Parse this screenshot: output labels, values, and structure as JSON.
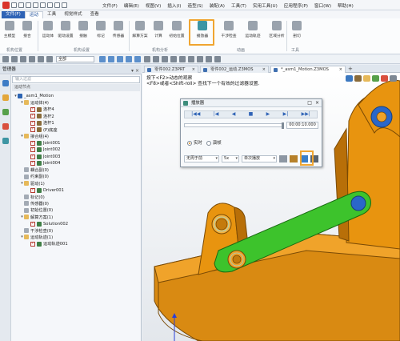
{
  "menu": {
    "file": "文件(F)",
    "items": [
      "文件(F)",
      "编辑(E)",
      "视图(V)",
      "插入(I)",
      "造型(S)",
      "装配(A)",
      "工具(T)",
      "实用工具(U)",
      "应用程序(P)",
      "窗口(W)",
      "帮助(H)"
    ]
  },
  "ribbon_tabs": {
    "file": "文件(F)",
    "items": [
      "运动",
      "工具",
      "视觉样式",
      "查看"
    ]
  },
  "ribbon": {
    "buttons": [
      "主模型",
      "接合",
      "运动体",
      "驱动设置",
      "接触",
      "标记",
      "传感器",
      "解算方案",
      "计算",
      "初始位置",
      "播放器",
      "干涉检查",
      "运动轨迹",
      "区域分析",
      "剖切",
      "测量"
    ],
    "groups": [
      "机构位置",
      "机构设置",
      "机构分析",
      "动画",
      "工具"
    ]
  },
  "toolbar": {
    "select_value": "全部"
  },
  "left_panel": {
    "title": "管理器",
    "filter_placeholder": "输入过滤",
    "header": "运动节点",
    "tree": [
      {
        "label": "_asm1_Motion",
        "level": 0,
        "expand": "▾",
        "type": "root"
      },
      {
        "label": "运动体(4)",
        "level": 1,
        "expand": "▾",
        "type": "folder"
      },
      {
        "label": "连杆4",
        "level": 2,
        "expand": "",
        "type": "body",
        "checked": true
      },
      {
        "label": "连杆2",
        "level": 2,
        "expand": "",
        "type": "body",
        "checked": true
      },
      {
        "label": "连杆1",
        "level": 2,
        "expand": "",
        "type": "body",
        "checked": true
      },
      {
        "label": "(P)底座",
        "level": 2,
        "expand": "",
        "type": "body",
        "checked": true
      },
      {
        "label": "接合组(4)",
        "level": 1,
        "expand": "▾",
        "type": "folder"
      },
      {
        "label": "Joint001",
        "level": 2,
        "expand": "",
        "type": "joint",
        "checked": true
      },
      {
        "label": "Joint002",
        "level": 2,
        "expand": "",
        "type": "joint",
        "checked": true
      },
      {
        "label": "Joint003",
        "level": 2,
        "expand": "",
        "type": "joint",
        "checked": true
      },
      {
        "label": "Joint004",
        "level": 2,
        "expand": "",
        "type": "joint",
        "checked": true
      },
      {
        "label": "耦合副(0)",
        "level": 1,
        "expand": "",
        "type": "gray"
      },
      {
        "label": "约束副(0)",
        "level": 1,
        "expand": "",
        "type": "gray"
      },
      {
        "label": "驱动(1)",
        "level": 1,
        "expand": "▾",
        "type": "folder"
      },
      {
        "label": "Driver001",
        "level": 2,
        "expand": "",
        "type": "joint",
        "checked": true
      },
      {
        "label": "标记(0)",
        "level": 1,
        "expand": "",
        "type": "gray"
      },
      {
        "label": "传感器(0)",
        "level": 1,
        "expand": "",
        "type": "gray"
      },
      {
        "label": "初始位置(0)",
        "level": 1,
        "expand": "",
        "type": "gray"
      },
      {
        "label": "解算方案(1)",
        "level": 1,
        "expand": "▾",
        "type": "folder"
      },
      {
        "label": "Solution002",
        "level": 2,
        "expand": "",
        "type": "joint",
        "checked": true
      },
      {
        "label": "干涉检查(0)",
        "level": 1,
        "expand": "",
        "type": "gray"
      },
      {
        "label": "运动轨迹(1)",
        "level": 1,
        "expand": "▾",
        "type": "folder"
      },
      {
        "label": "运动轨迹001",
        "level": 2,
        "expand": "",
        "type": "joint",
        "checked": true
      }
    ]
  },
  "doc_tabs": [
    {
      "label": "零件002.Z3PRT",
      "active": false
    },
    {
      "label": "零件002_运动.Z3MOS",
      "active": false
    },
    {
      "label": "*_asm1_Motion.Z3MOS",
      "active": true
    }
  ],
  "viewport": {
    "hint_line1": "按下<F2>动态的观察",
    "hint_line2": "<F8>或者<Shift-roll> 查找下一个有效的过滤器设置."
  },
  "dialog": {
    "title": "播放器",
    "time": "00:00:10.000",
    "radio_realtime": "实时",
    "radio_snapshot": "演帧",
    "loop_select": "无周于前",
    "speed_select": "5x",
    "mode_select": "单次播放"
  },
  "colors": {
    "accent": "#2f63b6",
    "highlight": "#f0a531",
    "part_orange": "#e8940f",
    "link_green": "#3dc32c",
    "joint_blue": "#2a67c9"
  }
}
